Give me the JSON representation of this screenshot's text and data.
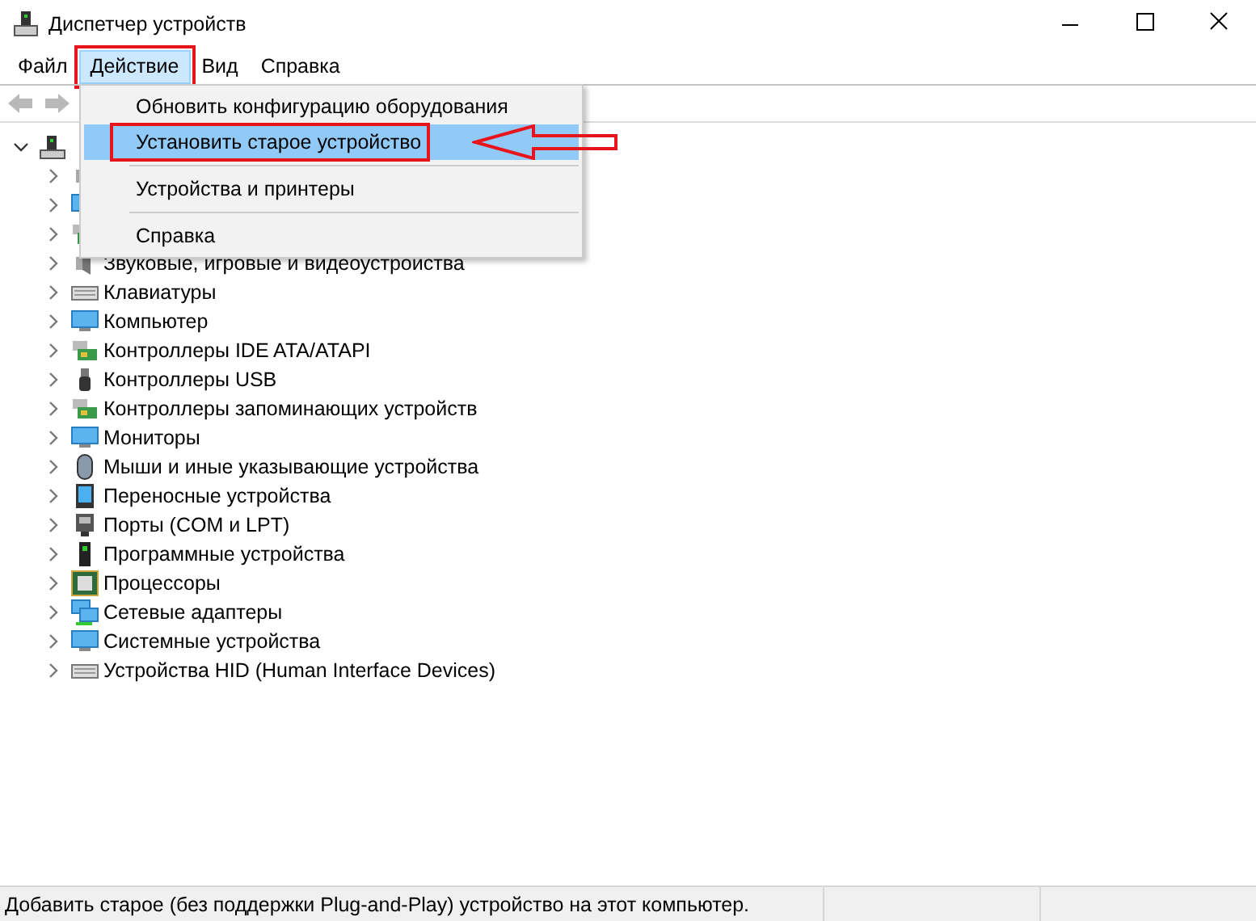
{
  "window": {
    "title": "Диспетчер устройств"
  },
  "menu_bar": [
    {
      "label": "Файл",
      "selected": false,
      "annotated": false
    },
    {
      "label": "Действие",
      "selected": true,
      "annotated": true
    },
    {
      "label": "Вид",
      "selected": false,
      "annotated": false
    },
    {
      "label": "Справка",
      "selected": false,
      "annotated": false
    }
  ],
  "toolbar": [
    {
      "kind": "back",
      "disabled": true
    },
    {
      "kind": "forward",
      "disabled": true
    }
  ],
  "dropdown": [
    {
      "kind": "item",
      "label": "Обновить конфигурацию оборудования",
      "selected": false,
      "annotated": false
    },
    {
      "kind": "item",
      "label": "Установить старое устройство",
      "selected": true,
      "annotated": true
    },
    {
      "kind": "separator"
    },
    {
      "kind": "item",
      "label": "Устройства и принтеры",
      "selected": false,
      "annotated": false
    },
    {
      "kind": "separator"
    },
    {
      "kind": "item",
      "label": "Справка",
      "selected": false,
      "annotated": false
    }
  ],
  "tree": [
    {
      "kind": "pc",
      "expanded": true,
      "children": [
        {
          "kind": "audio",
          "expanded": false
        },
        {
          "kind": "display",
          "expanded": false
        },
        {
          "kind": "drive",
          "expanded": false
        },
        {
          "kind": "sound",
          "label": "Звуковые, игровые и видеоустройства",
          "expanded": false
        },
        {
          "kind": "keyboard",
          "label": "Клавиатуры",
          "expanded": false
        },
        {
          "kind": "computer",
          "label": "Компьютер",
          "expanded": false
        },
        {
          "kind": "controller",
          "label": "Контроллеры IDE ATA/ATAPI",
          "expanded": false
        },
        {
          "kind": "usb",
          "label": "Контроллеры USB",
          "expanded": false
        },
        {
          "kind": "storage",
          "label": "Контроллеры запоминающих устройств",
          "expanded": false
        },
        {
          "kind": "computer",
          "label": "Мониторы",
          "expanded": false
        },
        {
          "kind": "mouse",
          "label": "Мыши и иные указывающие устройства",
          "expanded": false
        },
        {
          "kind": "portable",
          "label": "Переносные устройства",
          "expanded": false
        },
        {
          "kind": "port",
          "label": "Порты (COM и LPT)",
          "expanded": false
        },
        {
          "kind": "software",
          "label": "Программные устройства",
          "expanded": false
        },
        {
          "kind": "cpu",
          "label": "Процессоры",
          "expanded": false
        },
        {
          "kind": "network",
          "label": "Сетевые адаптеры",
          "expanded": false
        },
        {
          "kind": "system",
          "label": "Системные устройства",
          "expanded": false
        },
        {
          "kind": "hid",
          "label": "Устройства HID (Human Interface Devices)",
          "expanded": false
        }
      ]
    }
  ],
  "status_bar": {
    "text": "Добавить старое (без поддержки Plug-and-Play) устройство на этот компьютер."
  }
}
